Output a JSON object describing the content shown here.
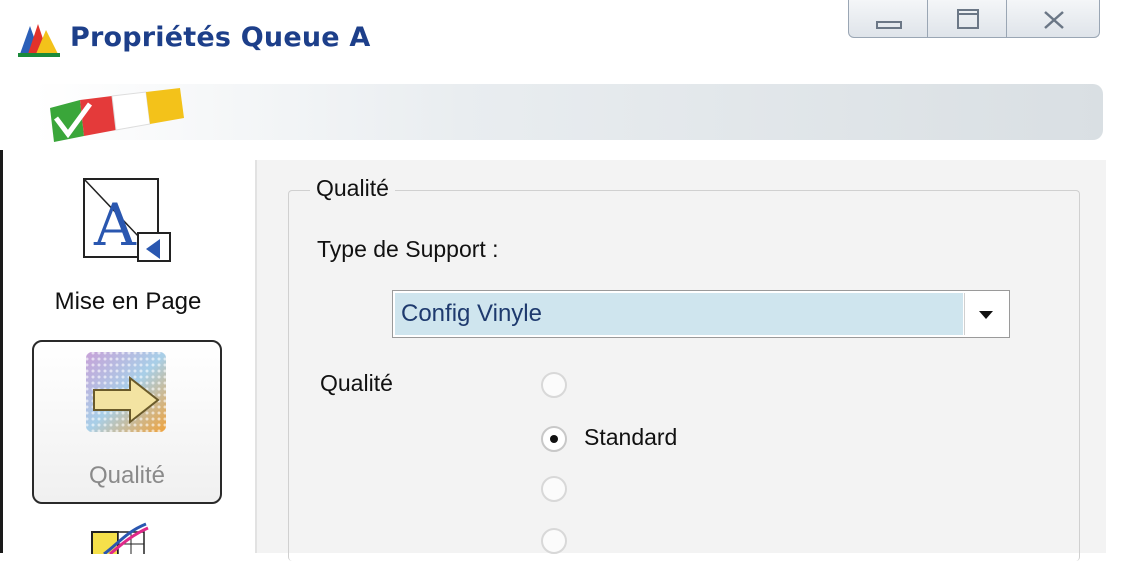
{
  "window": {
    "title": "Propriétés Queue A"
  },
  "sidebar": {
    "items": [
      {
        "label": "Mise en Page",
        "icon": "page-layout-icon",
        "selected": false
      },
      {
        "label": "Qualité",
        "icon": "quality-icon",
        "selected": true,
        "disabled_look": true
      },
      {
        "label": "",
        "icon": "color-curve-icon",
        "selected": false
      }
    ]
  },
  "panel": {
    "group_title": "Qualité",
    "media_type_label": "Type de Support :",
    "media_type_value": "Config Vinyle",
    "quality_label": "Qualité",
    "quality_options": [
      {
        "label": "",
        "checked": false,
        "enabled": false
      },
      {
        "label": "Standard",
        "checked": true,
        "enabled": true
      },
      {
        "label": "",
        "checked": false,
        "enabled": false
      },
      {
        "label": "",
        "checked": false,
        "enabled": false
      }
    ]
  },
  "colors": {
    "title_text": "#1d3f8a",
    "combo_highlight": "#cfe5ee",
    "panel_bg": "#f3f3f3",
    "disabled_text": "#8a8a8a"
  }
}
